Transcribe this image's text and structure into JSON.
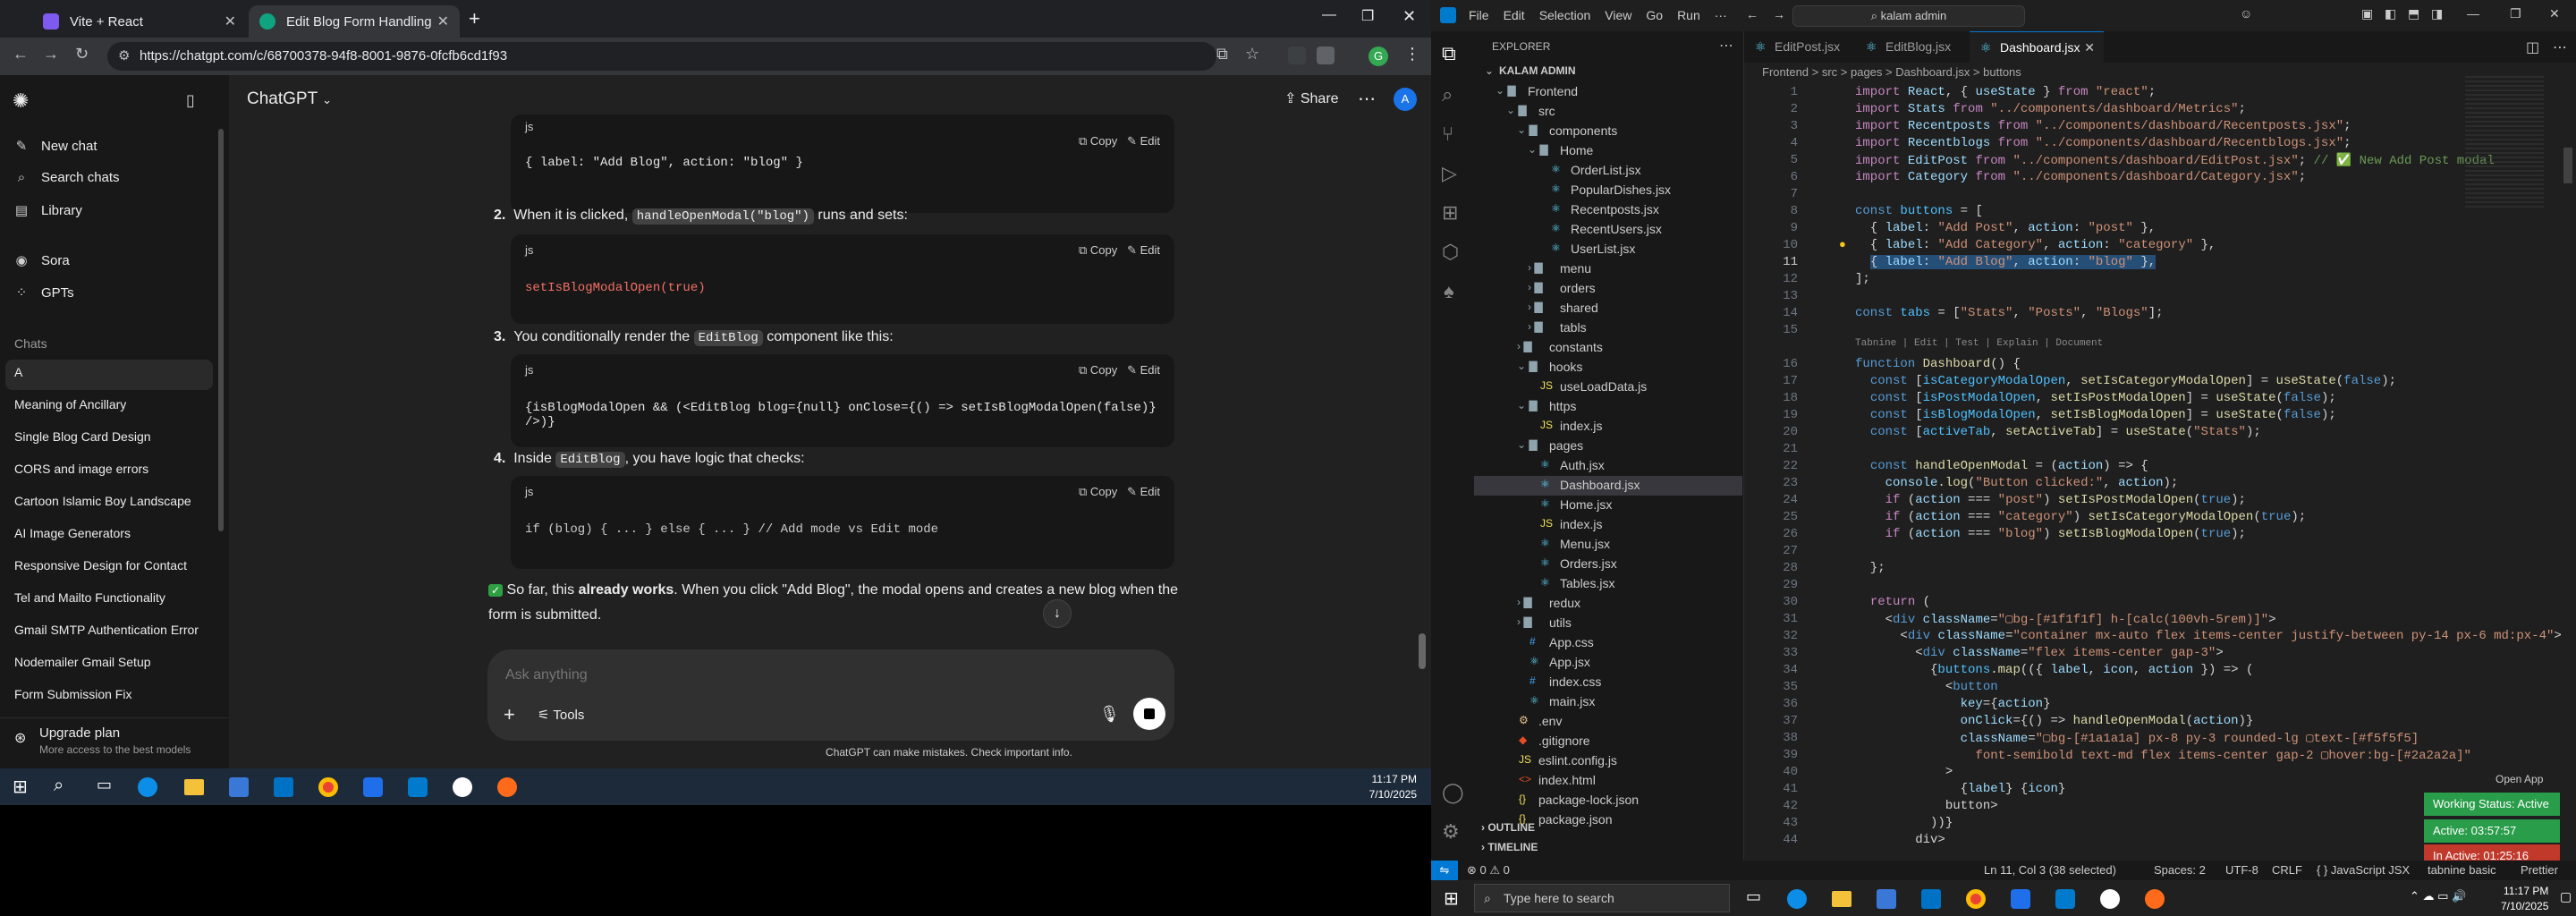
{
  "browser": {
    "tabs": [
      {
        "title": "Vite + React",
        "color": "#7f5af0"
      },
      {
        "title": "Edit Blog Form Handling",
        "color": "#10a37f"
      }
    ],
    "url": "https://chatgpt.com/c/68700378-94f8-8001-9876-0fcfb6cd1f93"
  },
  "sidebar": {
    "top": [
      {
        "label": "New chat",
        "icon": "✎"
      },
      {
        "label": "Search chats",
        "icon": "⌕"
      },
      {
        "label": "Library",
        "icon": "▤"
      }
    ],
    "apps": [
      {
        "label": "Sora",
        "icon": "◉"
      },
      {
        "label": "GPTs",
        "icon": "⁘"
      }
    ],
    "chats_heading": "Chats",
    "chats": [
      "A",
      "Meaning of Ancillary",
      "Single Blog Card Design",
      "CORS and image errors",
      "Cartoon Islamic Boy Landscape",
      "AI Image Generators",
      "Responsive Design for Contact",
      "Tel and Mailto Functionality",
      "Gmail SMTP Authentication Error",
      "Nodemailer Gmail Setup",
      "Form Submission Fix"
    ],
    "upgrade": {
      "title": "Upgrade plan",
      "sub": "More access to the best models"
    }
  },
  "header": {
    "model": "ChatGPT",
    "share": "Share",
    "avatar": "A"
  },
  "code_labels": {
    "lang": "js",
    "copy": "Copy",
    "edit": "Edit"
  },
  "conversation": {
    "block0": "{ label: \"Add Blog\", action: \"blog\" }",
    "step2": {
      "num": "2.",
      "pre": "When it is clicked, ",
      "code": "handleOpenModal(\"blog\")",
      "post": " runs and sets:"
    },
    "block1": "setIsBlogModalOpen(true)",
    "step3": {
      "num": "3.",
      "pre": "You conditionally render the ",
      "code": "EditBlog",
      "post": " component like this:"
    },
    "block2": "{isBlogModalOpen && (<EditBlog blog={null} onClose={() => setIsBlogModalOpen(false)} />)}",
    "step4": {
      "num": "4.",
      "pre": "Inside ",
      "code": "EditBlog",
      "post": ", you have logic that checks:"
    },
    "block3": "if (blog) { ... } else { ... } // Add mode vs Edit mode",
    "final_pre": "So far, this ",
    "final_bold": "already works",
    "final_post": ". When you click \"Add Blog\", the modal opens and creates a new blog when the",
    "final_line2": "form is submitted."
  },
  "composer": {
    "placeholder": "Ask anything",
    "tools": "Tools",
    "disclaimer": "ChatGPT can make mistakes. Check important info."
  },
  "taskbar_left": {
    "time": "11:17 PM",
    "date": "7/10/2025"
  },
  "vscode": {
    "menu": [
      "File",
      "Edit",
      "Selection",
      "View",
      "Go",
      "Run",
      "···"
    ],
    "search": "kalam admin",
    "explorer_title": "EXPLORER",
    "tree": [
      {
        "t": "KALAM ADMIN",
        "d": 0,
        "k": "root"
      },
      {
        "t": "Frontend",
        "d": 1,
        "k": "open"
      },
      {
        "t": "src",
        "d": 2,
        "k": "open"
      },
      {
        "t": "components",
        "d": 3,
        "k": "open"
      },
      {
        "t": "Home",
        "d": 4,
        "k": "open"
      },
      {
        "t": "OrderList.jsx",
        "d": 5,
        "k": "jsx"
      },
      {
        "t": "PopularDishes.jsx",
        "d": 5,
        "k": "jsx"
      },
      {
        "t": "Recentposts.jsx",
        "d": 5,
        "k": "jsx"
      },
      {
        "t": "RecentUsers.jsx",
        "d": 5,
        "k": "jsx"
      },
      {
        "t": "UserList.jsx",
        "d": 5,
        "k": "jsx"
      },
      {
        "t": "menu",
        "d": 4,
        "k": "closed"
      },
      {
        "t": "orders",
        "d": 4,
        "k": "closed"
      },
      {
        "t": "shared",
        "d": 4,
        "k": "closed"
      },
      {
        "t": "tabls",
        "d": 4,
        "k": "closed"
      },
      {
        "t": "constants",
        "d": 3,
        "k": "closed"
      },
      {
        "t": "hooks",
        "d": 3,
        "k": "open"
      },
      {
        "t": "useLoadData.js",
        "d": 4,
        "k": "js"
      },
      {
        "t": "https",
        "d": 3,
        "k": "open"
      },
      {
        "t": "index.js",
        "d": 4,
        "k": "js"
      },
      {
        "t": "pages",
        "d": 3,
        "k": "open"
      },
      {
        "t": "Auth.jsx",
        "d": 4,
        "k": "jsx"
      },
      {
        "t": "Dashboard.jsx",
        "d": 4,
        "k": "jsx",
        "sel": true
      },
      {
        "t": "Home.jsx",
        "d": 4,
        "k": "jsx"
      },
      {
        "t": "index.js",
        "d": 4,
        "k": "js"
      },
      {
        "t": "Menu.jsx",
        "d": 4,
        "k": "jsx"
      },
      {
        "t": "Orders.jsx",
        "d": 4,
        "k": "jsx"
      },
      {
        "t": "Tables.jsx",
        "d": 4,
        "k": "jsx"
      },
      {
        "t": "redux",
        "d": 3,
        "k": "closed"
      },
      {
        "t": "utils",
        "d": 3,
        "k": "closed"
      },
      {
        "t": "App.css",
        "d": 3,
        "k": "css"
      },
      {
        "t": "App.jsx",
        "d": 3,
        "k": "jsx"
      },
      {
        "t": "index.css",
        "d": 3,
        "k": "css"
      },
      {
        "t": "main.jsx",
        "d": 3,
        "k": "jsx"
      },
      {
        "t": ".env",
        "d": 2,
        "k": "env"
      },
      {
        "t": ".gitignore",
        "d": 2,
        "k": "git"
      },
      {
        "t": "eslint.config.js",
        "d": 2,
        "k": "js"
      },
      {
        "t": "index.html",
        "d": 2,
        "k": "html"
      },
      {
        "t": "package-lock.json",
        "d": 2,
        "k": "json"
      },
      {
        "t": "package.json",
        "d": 2,
        "k": "json"
      }
    ],
    "outline": "OUTLINE",
    "timeline": "TIMELINE",
    "tabs": [
      "EditPost.jsx",
      "EditBlog.jsx",
      "Dashboard.jsx"
    ],
    "breadcrumb": "Frontend > src > pages > Dashboard.jsx > buttons",
    "codelens": "Tabnine | Edit | Test | Explain | Document",
    "status": {
      "errors": "⊗ 0 ⚠ 0",
      "position": "Ln 11, Col 3 (38 selected)",
      "spaces": "Spaces: 2",
      "enc": "UTF-8",
      "eol": "CRLF",
      "lang": "{ } JavaScript JSX",
      "tabnine": "tabnine basic",
      "prettier": "Prettier"
    },
    "open_app": "Open App",
    "working": "Working Status: Active",
    "active": "Active: 03:57:57",
    "inactive": "In Active: 01:25:16",
    "task_search": "Type here to search",
    "time": "11:17 PM",
    "date": "7/10/2025"
  }
}
